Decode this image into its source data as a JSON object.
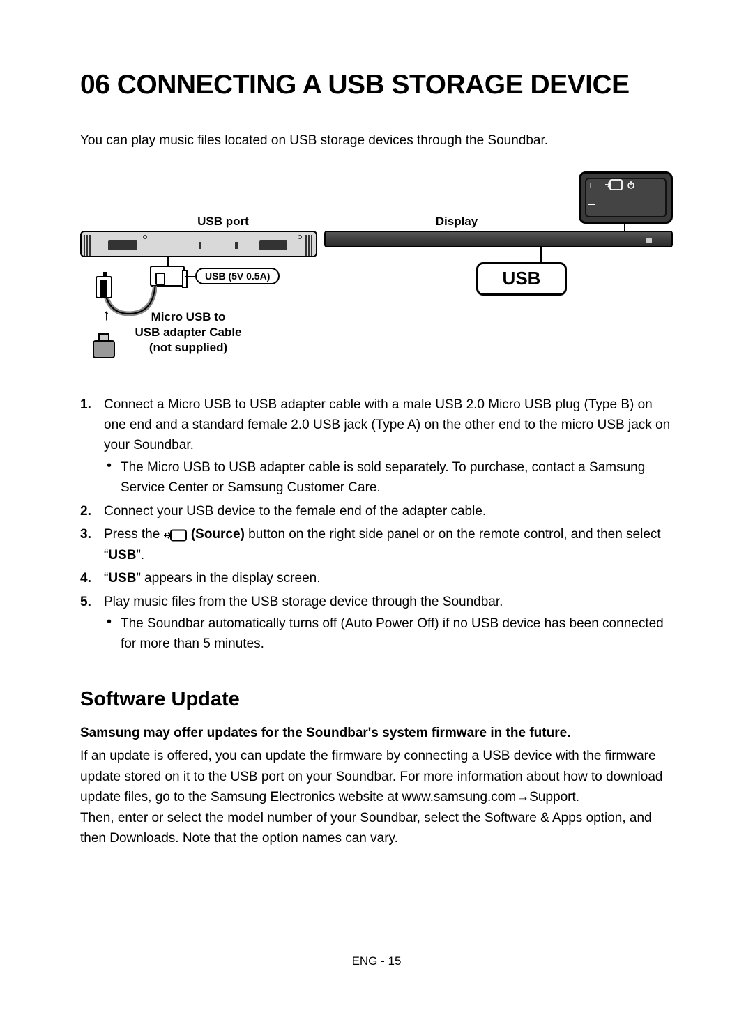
{
  "heading": "06  CONNECTING A USB STORAGE DEVICE",
  "intro": "You can play music files located on USB storage devices through the Soundbar.",
  "diagram": {
    "usb_port_label": "USB port",
    "display_label": "Display",
    "adapter_label_l1": "Micro USB to",
    "adapter_label_l2": "USB adapter Cable",
    "adapter_label_l3": "(not supplied)",
    "port_pill": "USB (5V 0.5A)",
    "usb_badge": "USB",
    "control_plus": "+",
    "control_minus": "–"
  },
  "steps": {
    "s1": "Connect a Micro USB to USB adapter cable with a male USB 2.0 Micro USB plug (Type B) on one end and a standard female 2.0 USB jack (Type A) on the other end to the micro USB jack on your Soundbar.",
    "s1_sub": "The Micro USB to USB adapter cable is sold separately. To purchase, contact a Samsung Service Center or Samsung Customer Care.",
    "s2": "Connect your USB device to the female end of the adapter cable.",
    "s3_a": "Press the ",
    "s3_source": "(Source)",
    "s3_b": " button on the right side panel or on the remote control, and then select “",
    "s3_usb": "USB",
    "s3_c": "”.",
    "s4_a": "“",
    "s4_usb": "USB",
    "s4_b": "” appears in the display screen.",
    "s5": "Play music files from the USB storage device through the Soundbar.",
    "s5_sub": "The Soundbar automatically turns off (Auto Power Off) if no USB device has been connected for more than 5 minutes."
  },
  "software": {
    "title": "Software Update",
    "bold": "Samsung may offer updates for the Soundbar's system firmware in the future.",
    "p1": "If an update is offered, you can update the firmware by connecting a USB device with the firmware update stored on it to the USB port on your Soundbar. For more information about how to download update files, go to the Samsung Electronics website at www.samsung.com→Support.",
    "p2": "Then, enter or select the model number of your Soundbar, select the Software & Apps option, and then Downloads. Note that the option names can vary."
  },
  "footer": "ENG - 15"
}
